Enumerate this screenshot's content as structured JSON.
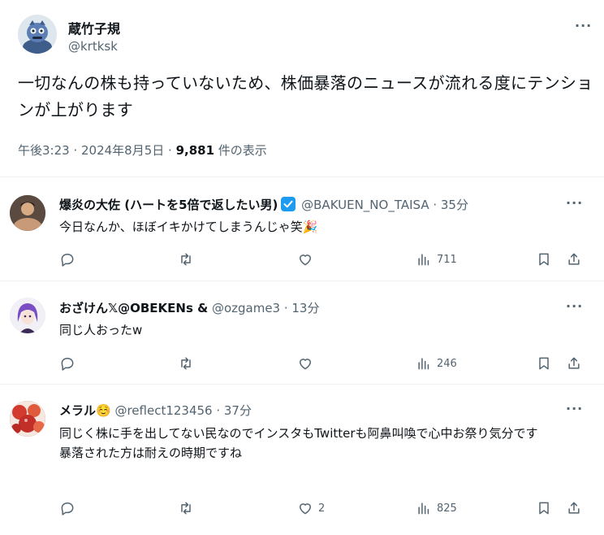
{
  "main_tweet": {
    "name": "蔵竹子規",
    "handle": "@krtksk",
    "more_icon": "more-icon",
    "text": "一切なんの株も持っていないため、株価暴落のニュースが流れる度にテンションが上がります",
    "time": "午後3:23 · 2024年8月5日 · ",
    "views_count": "9,881",
    "views_label": " 件の表示"
  },
  "replies": [
    {
      "name": "爆炎の大佐 (ハートを5倍で返したい男)",
      "verified": true,
      "rest": " @BAKUEN_NO_TAISA · 35分",
      "text": "今日なんか、ほぼイキかけてしまうんじゃ笑🎉",
      "reply_count": "",
      "retweet_count": "",
      "like_count": "",
      "views": "711"
    },
    {
      "name": "おざけん𝕏@OBEKENs &",
      "verified": false,
      "rest": " @ozgame3 · 13分",
      "text": "同じ人おったw",
      "reply_count": "",
      "retweet_count": "",
      "like_count": "",
      "views": "246"
    },
    {
      "name": "メラル☺️",
      "verified": false,
      "rest": " @reflect123456 · 37分",
      "text": "同じく株に手を出してない民なのでインスタもTwitterも阿鼻叫喚で心中お祭り気分です\n暴落された方は耐えの時期ですね",
      "reply_count": "",
      "retweet_count": "",
      "like_count": "2",
      "views": "825"
    }
  ],
  "colors": {
    "text": "#0f1419",
    "secondary": "#536471",
    "verified": "#1d9bf0",
    "divider": "#eff3f4"
  }
}
